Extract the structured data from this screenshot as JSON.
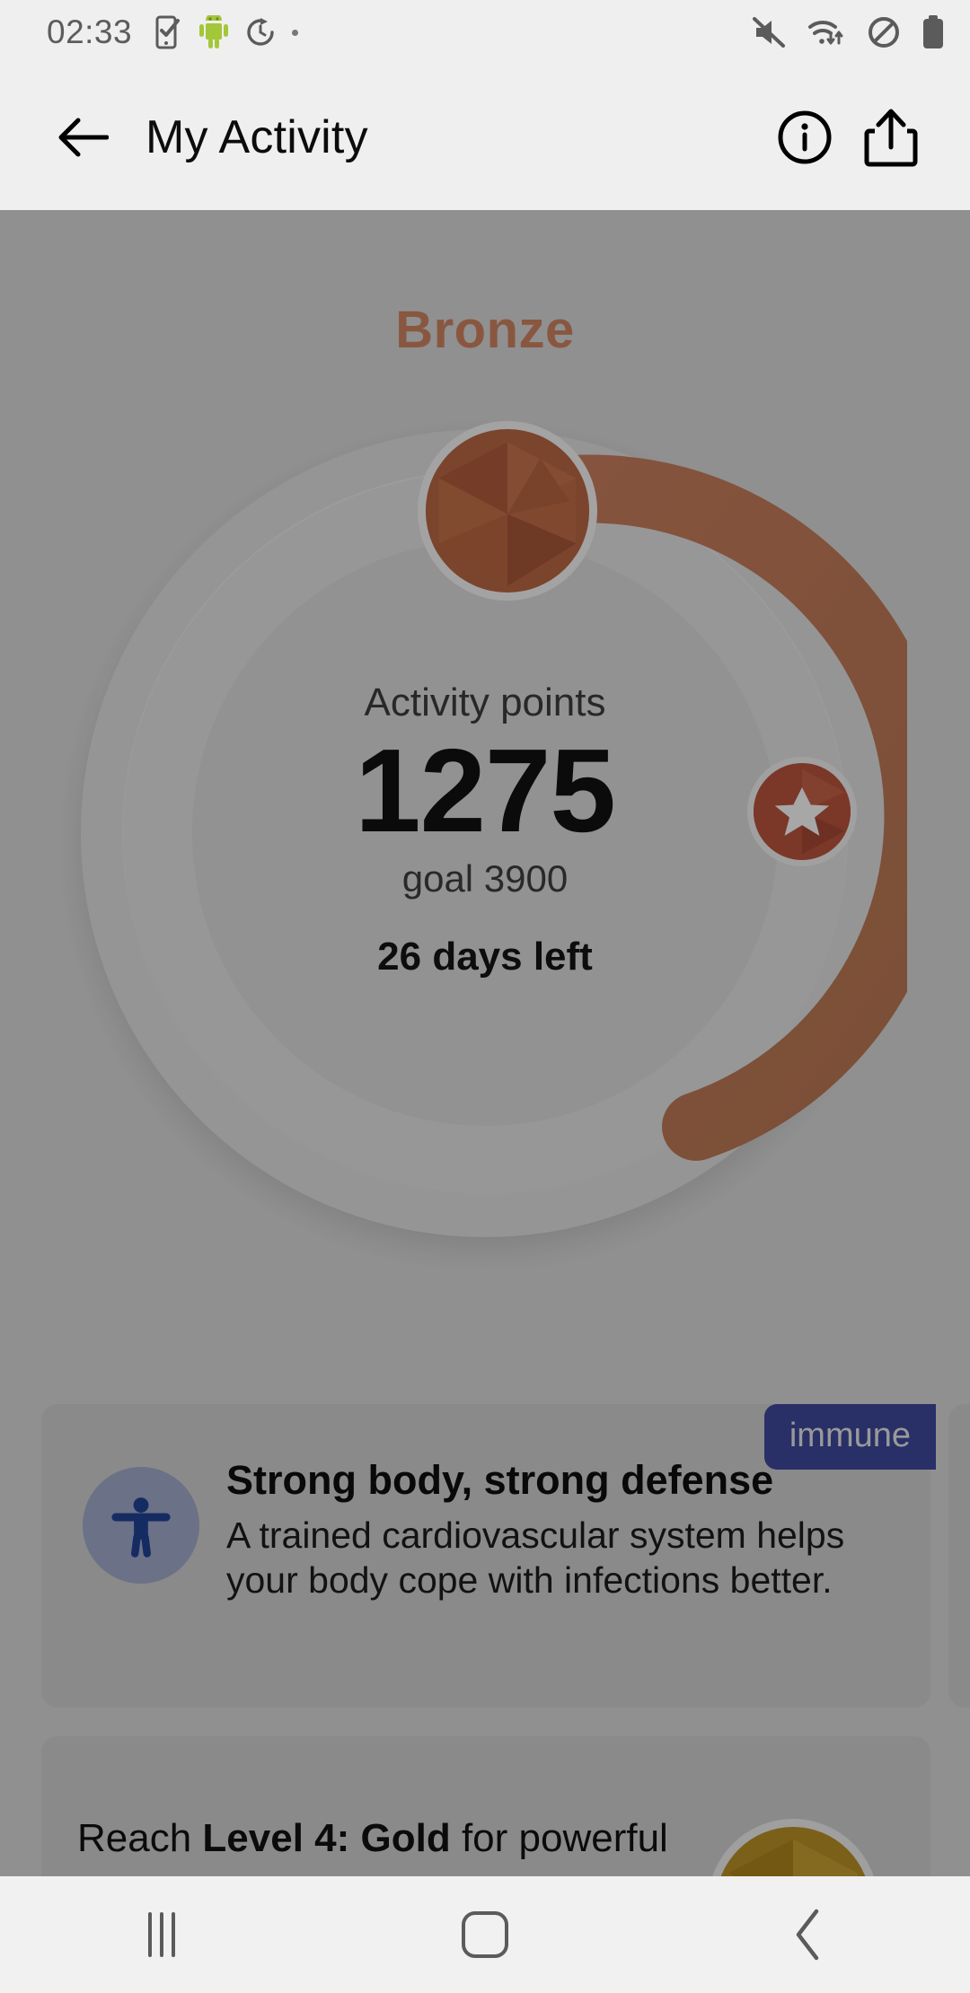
{
  "status_bar": {
    "time": "02:33",
    "left_icons": [
      "phone-check-icon",
      "android-robot-icon",
      "timer-reset-icon",
      "small-dot-icon"
    ],
    "right_icons": [
      "mute-icon",
      "wifi-icon",
      "do-not-disturb-icon",
      "battery-full-icon"
    ]
  },
  "app_bar": {
    "back_label": "back-arrow",
    "title": "My Activity",
    "info_label": "info",
    "share_label": "share"
  },
  "activity": {
    "level_name": "Bronze",
    "points_label": "Activity points",
    "points_value": "1275",
    "goal_text": "goal 3900",
    "days_left": "26 days left",
    "accent_color": "#b1623f",
    "badge_color": "#b1503a",
    "progress_percent": 33
  },
  "cards": [
    {
      "badge": "immune",
      "badge_color": "#3b4694",
      "icon": "accessibility-icon",
      "title": "Strong body, strong defense",
      "text": "A trained cardiovascular system helps your body cope with infections better."
    }
  ],
  "next_level_card": {
    "prefix": "Reach ",
    "highlight": "Level 4: Gold",
    "suffix": " for powerful",
    "gem_color": "#b08a24"
  },
  "nav_bar": {
    "recents_label": "recents",
    "home_label": "home",
    "back_label": "back"
  }
}
